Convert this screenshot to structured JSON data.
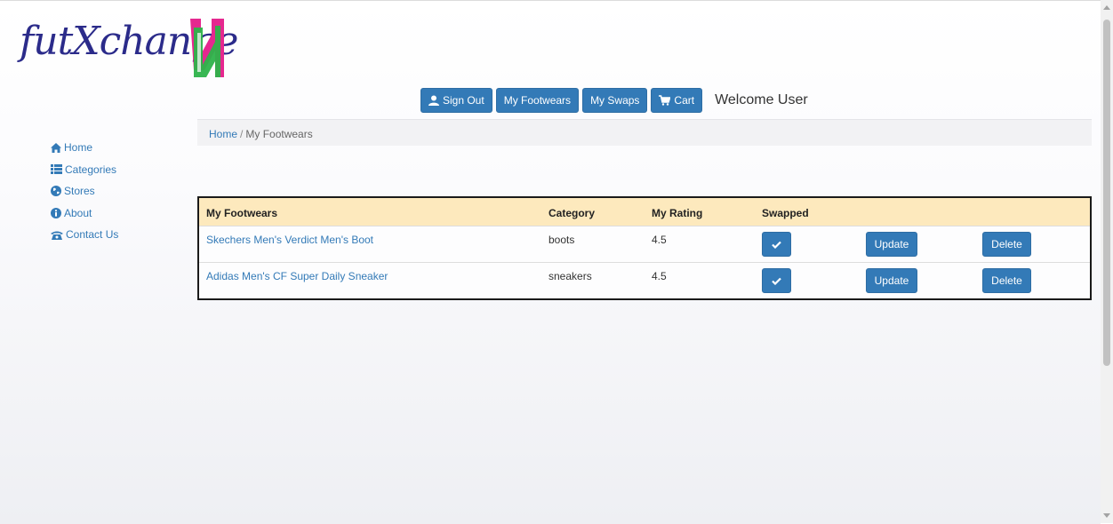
{
  "logo": {
    "text": "futXchange",
    "colors": {
      "text": "#2b2b8a",
      "mark_magenta": "#e5288f",
      "mark_green": "#2db34a"
    }
  },
  "topnav": {
    "sign_out": "Sign Out",
    "my_footwears": "My Footwears",
    "my_swaps": "My Swaps",
    "cart": "Cart",
    "welcome": "Welcome User"
  },
  "sidebar": {
    "items": [
      {
        "label": "Home",
        "icon": "home-icon"
      },
      {
        "label": "Categories",
        "icon": "list-icon"
      },
      {
        "label": "Stores",
        "icon": "globe-icon"
      },
      {
        "label": "About",
        "icon": "info-icon"
      },
      {
        "label": "Contact Us",
        "icon": "phone-icon"
      }
    ]
  },
  "breadcrumb": {
    "home": "Home",
    "separator": "/",
    "current": "My Footwears"
  },
  "table": {
    "headers": {
      "name": "My Footwears",
      "category": "Category",
      "rating": "My Rating",
      "swapped": "Swapped"
    },
    "rows": [
      {
        "name": "Skechers Men's Verdict Men's Boot",
        "category": "boots",
        "rating": "4.5",
        "update": "Update",
        "delete": "Delete"
      },
      {
        "name": "Adidas Men's CF Super Daily Sneaker",
        "category": "sneakers",
        "rating": "4.5",
        "update": "Update",
        "delete": "Delete"
      }
    ],
    "colors": {
      "header_bg": "#fde9bd",
      "button": "#337ab7"
    }
  }
}
